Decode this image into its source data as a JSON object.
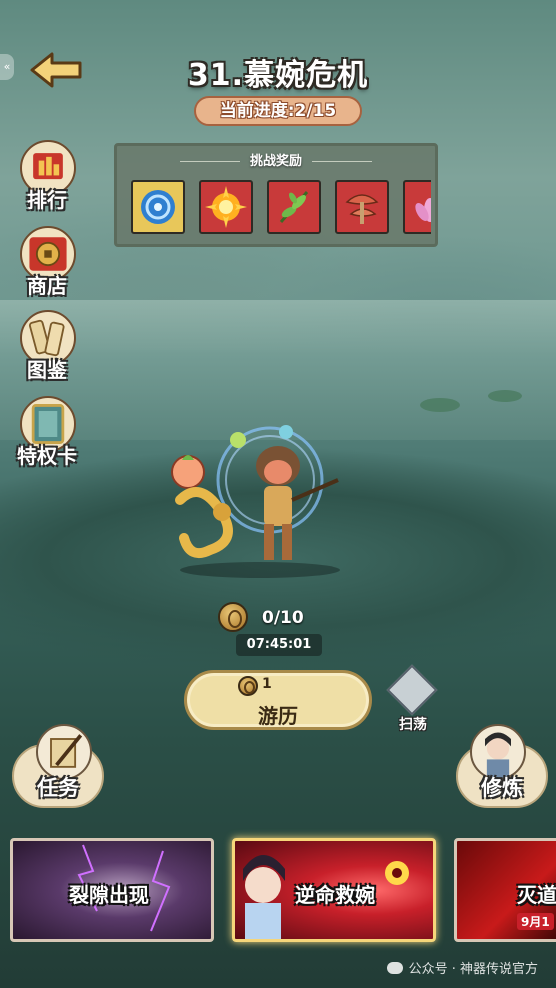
{
  "header": {
    "title": "31.慕婉危机",
    "progress": "当前进度:2/15"
  },
  "rewards": {
    "title": "挑战奖励",
    "items": [
      {
        "icon": "blue-vortex-orb-icon",
        "bg": "#e8c75a"
      },
      {
        "icon": "fire-burst-icon",
        "bg": "#c83a3a"
      },
      {
        "icon": "herb-leaf-icon",
        "bg": "#c83a3a"
      },
      {
        "icon": "lingzhi-mushroom-icon",
        "bg": "#c83a3a"
      },
      {
        "icon": "lotus-flower-icon",
        "bg": "#c83a3a"
      }
    ]
  },
  "side_menu": [
    {
      "label": "排行",
      "icon": "ranking-scroll-icon"
    },
    {
      "label": "商店",
      "icon": "shop-coin-icon"
    },
    {
      "label": "图鉴",
      "icon": "codex-scroll-icon"
    },
    {
      "label": "特权卡",
      "icon": "privilege-card-icon"
    }
  ],
  "resource": {
    "count": "0/10",
    "timer": "07:45:01"
  },
  "travel": {
    "cost": "1",
    "label": "游历"
  },
  "sweep": {
    "label": "扫荡"
  },
  "quest": {
    "label": "任务"
  },
  "cultivate": {
    "label": "修炼"
  },
  "events": [
    {
      "label": "裂隙出现"
    },
    {
      "label": "逆命救婉"
    },
    {
      "label": "灭道",
      "sub": "9月1"
    }
  ],
  "watermark": "公众号 · 神器传说官方"
}
